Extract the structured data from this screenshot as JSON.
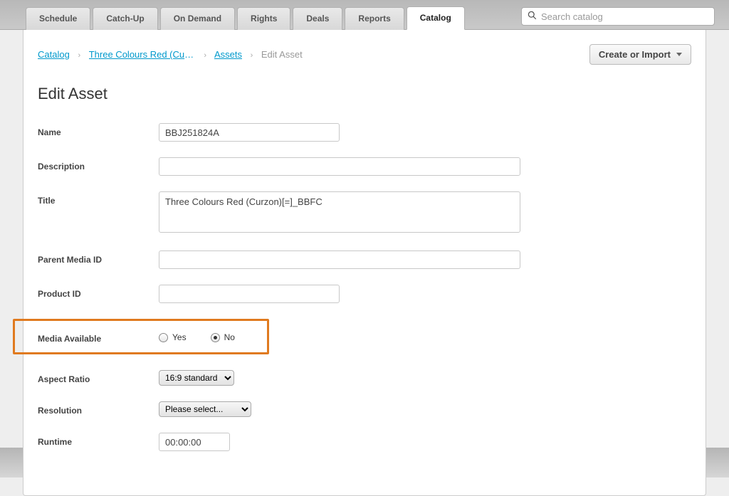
{
  "tabs": [
    {
      "label": "Schedule",
      "active": false
    },
    {
      "label": "Catch-Up",
      "active": false
    },
    {
      "label": "On Demand",
      "active": false
    },
    {
      "label": "Rights",
      "active": false
    },
    {
      "label": "Deals",
      "active": false
    },
    {
      "label": "Reports",
      "active": false
    },
    {
      "label": "Catalog",
      "active": true
    }
  ],
  "search": {
    "placeholder": "Search catalog",
    "value": ""
  },
  "breadcrumbs": {
    "items": [
      {
        "label": "Catalog",
        "link": true
      },
      {
        "label": "Three Colours Red (Curz…",
        "link": true
      },
      {
        "label": "Assets",
        "link": true
      },
      {
        "label": "Edit Asset",
        "link": false
      }
    ]
  },
  "action_button": {
    "label": "Create or Import"
  },
  "page_title": "Edit Asset",
  "form": {
    "name": {
      "label": "Name",
      "value": "BBJ251824A"
    },
    "description": {
      "label": "Description",
      "value": ""
    },
    "title": {
      "label": "Title",
      "value": "Three Colours Red (Curzon)[=]_BBFC"
    },
    "parent_media_id": {
      "label": "Parent Media ID",
      "value": ""
    },
    "product_id": {
      "label": "Product ID",
      "value": ""
    },
    "media_available": {
      "label": "Media Available",
      "options": [
        {
          "label": "Yes",
          "value": "yes",
          "selected": false
        },
        {
          "label": "No",
          "value": "no",
          "selected": true
        }
      ]
    },
    "aspect_ratio": {
      "label": "Aspect Ratio",
      "selected": "16:9 standard",
      "options": [
        "16:9 standard"
      ]
    },
    "resolution": {
      "label": "Resolution",
      "selected": "Please select...",
      "options": [
        "Please select..."
      ]
    },
    "runtime": {
      "label": "Runtime",
      "value": "00:00:00"
    }
  }
}
